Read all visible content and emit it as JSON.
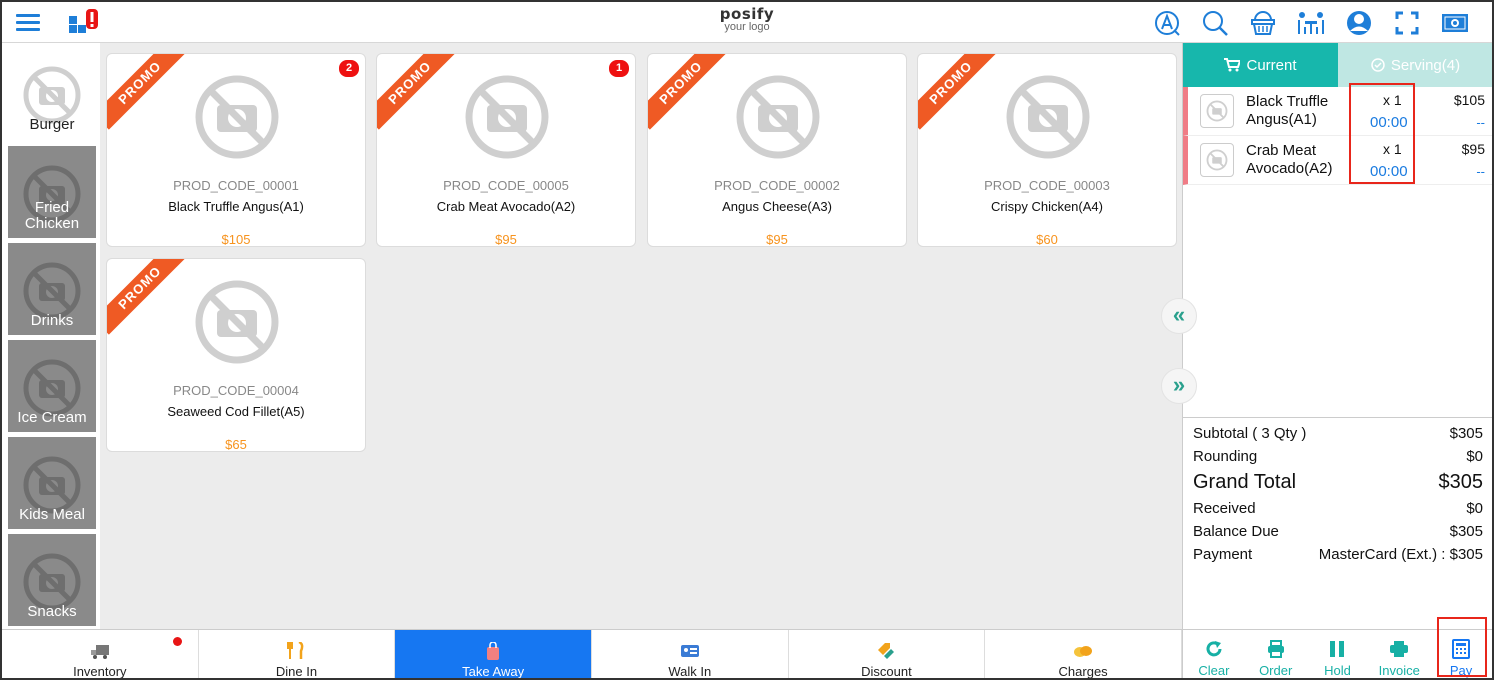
{
  "header": {
    "logo_main": "posify",
    "logo_sub": "your logo",
    "left_icons": [
      "menu-icon",
      "cube-alert-icon"
    ],
    "right_icons": [
      "font-a-icon",
      "search-icon",
      "basket-icon",
      "table-people-icon",
      "user-icon",
      "fullscreen-icon",
      "cash-icon"
    ]
  },
  "categories": [
    {
      "label": "Burger"
    },
    {
      "label": "Fried Chicken"
    },
    {
      "label": "Drinks"
    },
    {
      "label": "Ice Cream"
    },
    {
      "label": "Kids Meal"
    },
    {
      "label": "Snacks"
    }
  ],
  "products": [
    {
      "promo": "PROMO",
      "badge": "2",
      "code": "PROD_CODE_00001",
      "name": "Black Truffle Angus(A1)",
      "price": "$105"
    },
    {
      "promo": "PROMO",
      "badge": "1",
      "code": "PROD_CODE_00005",
      "name": "Crab Meat Avocado(A2)",
      "price": "$95"
    },
    {
      "promo": "PROMO",
      "badge": "",
      "code": "PROD_CODE_00002",
      "name": "Angus Cheese(A3)",
      "price": "$95"
    },
    {
      "promo": "PROMO",
      "badge": "",
      "code": "PROD_CODE_00003",
      "name": "Crispy Chicken(A4)",
      "price": "$60"
    },
    {
      "promo": "PROMO",
      "badge": "",
      "code": "PROD_CODE_00004",
      "name": "Seaweed Cod Fillet(A5)",
      "price": "$65"
    }
  ],
  "panel": {
    "tab_current": "Current",
    "tab_serving": "Serving(4)",
    "items": [
      {
        "name": "Black Truffle Angus(A1)",
        "qty": "x 1",
        "time": "00:00",
        "price": "$105",
        "discount": "--"
      },
      {
        "name": "Crab Meat Avocado(A2)",
        "qty": "x 1",
        "time": "00:00",
        "price": "$95",
        "discount": "--"
      }
    ],
    "collapse_left": "«",
    "collapse_right": "»",
    "totals": {
      "subtotal_label": "Subtotal ( 3 Qty )",
      "subtotal_value": "$305",
      "rounding_label": "Rounding",
      "rounding_value": "$0",
      "grand_label": "Grand Total",
      "grand_value": "$305",
      "received_label": "Received",
      "received_value": "$0",
      "balance_label": "Balance Due",
      "balance_value": "$305",
      "payment_label": "Payment",
      "payment_value": "MasterCard (Ext.) : $305"
    }
  },
  "bottom": [
    {
      "label": "Inventory",
      "icon": "truck-icon",
      "active": false,
      "dot": true
    },
    {
      "label": "Dine In",
      "icon": "utensils-icon",
      "active": false,
      "dot": false
    },
    {
      "label": "Take Away",
      "icon": "bag-icon",
      "active": true,
      "dot": false
    },
    {
      "label": "Walk In",
      "icon": "id-card-icon",
      "active": false,
      "dot": false
    },
    {
      "label": "Discount",
      "icon": "tags-icon",
      "active": false,
      "dot": false
    },
    {
      "label": "Charges",
      "icon": "coins-icon",
      "active": false,
      "dot": false
    }
  ],
  "actions": [
    {
      "label": "Clear",
      "icon": "refresh-icon"
    },
    {
      "label": "Order",
      "icon": "printer-icon"
    },
    {
      "label": "Hold",
      "icon": "pause-icon"
    },
    {
      "label": "Invoice",
      "icon": "printer-icon"
    },
    {
      "label": "Pay",
      "icon": "calculator-icon"
    }
  ],
  "colors": {
    "accent_teal": "#17b7ac",
    "accent_blue": "#1677f2",
    "promo_orange": "#ef5a24",
    "price_orange": "#f7931e",
    "highlight_red": "#e8261b"
  }
}
